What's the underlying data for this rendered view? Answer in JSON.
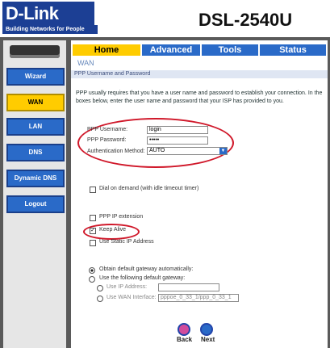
{
  "brand": {
    "logo": "D-Link",
    "tagline": "Building Networks for People",
    "model": "DSL-2540U"
  },
  "colors": {
    "accent_blue": "#2a6ac8",
    "active_yellow": "#ffcc00",
    "highlight_red": "#d0182a"
  },
  "sidebar": {
    "items": [
      {
        "label": "Wizard",
        "active": false
      },
      {
        "label": "WAN",
        "active": true
      },
      {
        "label": "LAN",
        "active": false
      },
      {
        "label": "DNS",
        "active": false
      },
      {
        "label": "Dynamic DNS",
        "active": false
      },
      {
        "label": "Logout",
        "active": false
      }
    ]
  },
  "tabs": [
    {
      "label": "Home",
      "active": true
    },
    {
      "label": "Advanced",
      "active": false
    },
    {
      "label": "Tools",
      "active": false
    },
    {
      "label": "Status",
      "active": false
    }
  ],
  "main": {
    "title": "WAN",
    "section": "PPP Username and Password",
    "description": "PPP usually requires that you have a user name and password to establish your connection. In the boxes below, enter the user name and password that your ISP has provided to you.",
    "ppp_username_label": "PPP Username:",
    "ppp_username_value": "login",
    "ppp_password_label": "PPP Password:",
    "ppp_password_value": "•••••",
    "auth_label": "Authentication Method:",
    "auth_value": "AUTO",
    "dial_on_demand": "Dial on demand (with idle timeout timer)",
    "ppp_ip_extension": "PPP IP extension",
    "keep_alive": "Keep Alive",
    "use_static_ip": "Use Static IP Address",
    "obtain_gateway": "Obtain default gateway automatically:",
    "use_gateway": "Use the following default gateway:",
    "use_ip_label": "Use IP Address:",
    "use_wan_label": "Use WAN Interface:",
    "wan_interface_value": "pppoe_0_33_1/ppp_0_33_1",
    "back_label": "Back",
    "next_label": "Next"
  }
}
